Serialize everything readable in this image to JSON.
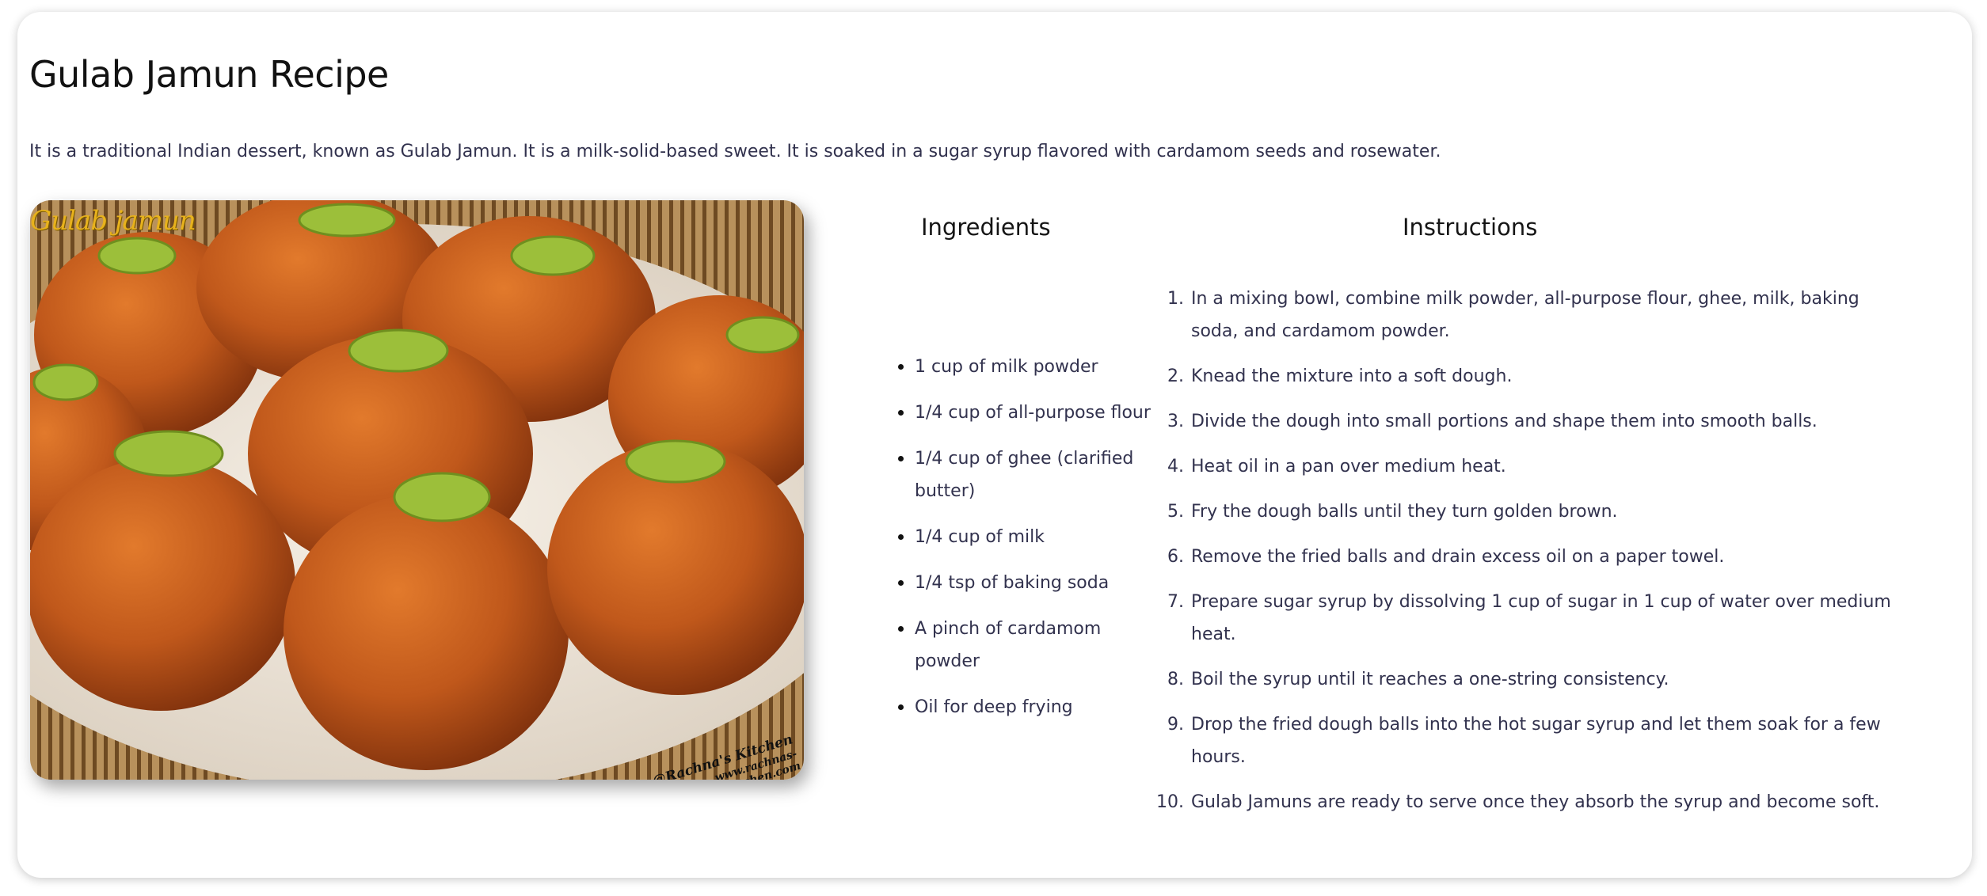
{
  "page": {
    "title": "Gulab Jamun Recipe",
    "description": "It is a traditional Indian dessert, known as Gulab Jamun. It is a milk-solid-based sweet. It is soaked in a sugar syrup flavored with cardamom seeds and rosewater."
  },
  "photo": {
    "caption": "Gulab jamun",
    "watermark_line1": "@Rachna's Kitchen",
    "watermark_line2": "www.rachnas-kitchen.com"
  },
  "ingredients": {
    "heading": "Ingredients",
    "items": [
      "1 cup of milk powder",
      "1/4 cup of all-purpose flour",
      "1/4 cup of ghee (clarified butter)",
      "1/4 cup of milk",
      "1/4 tsp of baking soda",
      "A pinch of cardamom powder",
      "Oil for deep frying"
    ]
  },
  "instructions": {
    "heading": "Instructions",
    "steps": [
      "In a mixing bowl, combine milk powder, all-purpose flour, ghee, milk, baking soda, and cardamom powder.",
      "Knead the mixture into a soft dough.",
      "Divide the dough into small portions and shape them into smooth balls.",
      "Heat oil in a pan over medium heat.",
      "Fry the dough balls until they turn golden brown.",
      "Remove the fried balls and drain excess oil on a paper towel.",
      "Prepare sugar syrup by dissolving 1 cup of sugar in 1 cup of water over medium heat.",
      "Boil the syrup until it reaches a one-string consistency.",
      "Drop the fried dough balls into the hot sugar syrup and let them soak for a few hours.",
      "Gulab Jamuns are ready to serve once they absorb the syrup and become soft."
    ]
  },
  "colors": {
    "text": "#32324e",
    "heading": "#121212",
    "caption": "#e8b21c",
    "jamun": "#b8541a",
    "pistachio": "#9cbf3a"
  }
}
